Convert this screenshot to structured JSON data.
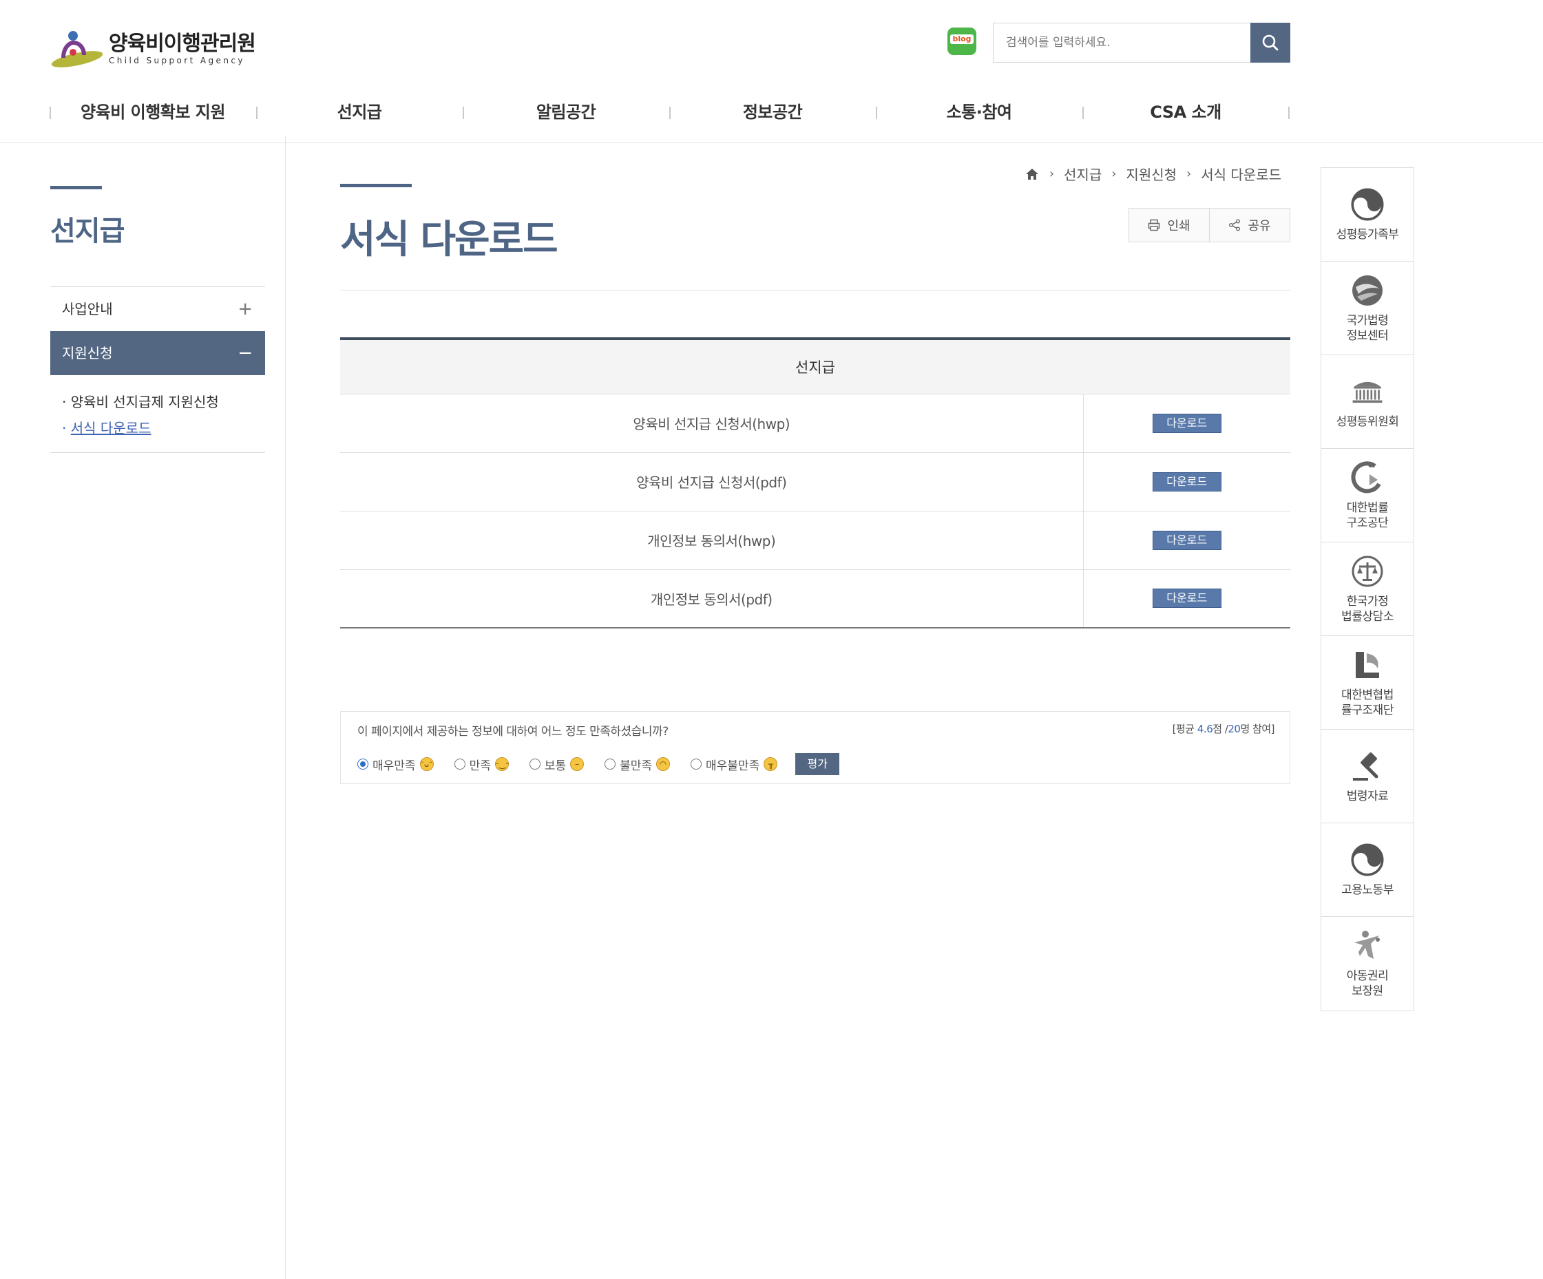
{
  "header": {
    "logo_title": "양육비이행관리원",
    "logo_sub": "Child Support Agency",
    "blog_label": "blog",
    "search_placeholder": "검색어를 입력하세요."
  },
  "gnb": [
    "양육비 이행확보 지원",
    "선지급",
    "알림공간",
    "정보공간",
    "소통·참여",
    "CSA 소개"
  ],
  "lnb": {
    "title": "선지급",
    "items": [
      {
        "label": "사업안내",
        "toggle": "+"
      },
      {
        "label": "지원신청",
        "toggle": "−"
      }
    ],
    "sub_items": [
      "양육비 선지급제 지원신청",
      "서식 다운로드"
    ]
  },
  "breadcrumb": [
    "선지급",
    "지원신청",
    "서식 다운로드"
  ],
  "content": {
    "title": "서식 다운로드",
    "print_label": "인쇄",
    "share_label": "공유"
  },
  "table": {
    "header": "선지급",
    "download_label": "다운로드",
    "rows": [
      "양육비 선지급 신청서(hwp)",
      "양육비 선지급 신청서(pdf)",
      "개인정보 동의서(hwp)",
      "개인정보 동의서(pdf)"
    ]
  },
  "survey": {
    "question": "이 페이지에서 제공하는 정보에 대하여 어느 정도 만족하셨습니까?",
    "avg_prefix": "[평균 ",
    "avg_score": "4.6",
    "avg_mid": "점 /",
    "avg_count": "20",
    "avg_suffix": "명 참여]",
    "options": [
      "매우만족",
      "만족",
      "보통",
      "불만족",
      "매우불만족"
    ],
    "selected": "매우만족",
    "submit_label": "평가"
  },
  "quick_links": [
    {
      "label": "성평등가족부",
      "icon": "government-emblem-icon"
    },
    {
      "label": "국가법령\n정보센터",
      "icon": "law-center-icon"
    },
    {
      "label": "성평등위원회",
      "icon": "building-icon"
    },
    {
      "label": "대한법률\n구조공단",
      "icon": "legal-aid-icon"
    },
    {
      "label": "한국가정\n법률상담소",
      "icon": "scales-icon"
    },
    {
      "label": "대한변협법\n률구조재단",
      "icon": "bar-foundation-icon"
    },
    {
      "label": "법령자료",
      "icon": "gavel-icon"
    },
    {
      "label": "고용노동부",
      "icon": "government-emblem-icon"
    },
    {
      "label": "아동권리\n보장원",
      "icon": "child-rights-icon"
    }
  ],
  "colors": {
    "primary": "#536783",
    "title": "#4e6586",
    "download_button": "#5879aa",
    "link_active": "#3d63b3"
  }
}
